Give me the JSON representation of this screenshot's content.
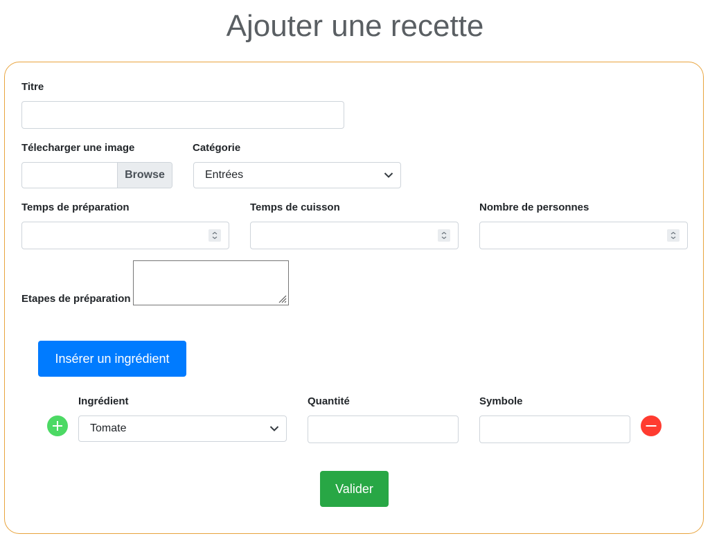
{
  "page": {
    "title": "Ajouter une recette"
  },
  "form": {
    "titre": {
      "label": "Titre",
      "value": ""
    },
    "image": {
      "label": "Télecharger une image",
      "browse_label": "Browse"
    },
    "categorie": {
      "label": "Catégorie",
      "selected": "Entrées"
    },
    "temps_preparation": {
      "label": "Temps de préparation",
      "value": ""
    },
    "temps_cuisson": {
      "label": "Temps de cuisson",
      "value": ""
    },
    "nombre_personnes": {
      "label": "Nombre de personnes",
      "value": ""
    },
    "etapes": {
      "label": "Etapes de préparation",
      "value": ""
    },
    "insert_ingredient_label": "Insérer un ingrédient",
    "ingredient_row": {
      "ingredient_label": "Ingrédient",
      "ingredient_selected": "Tomate",
      "quantite_label": "Quantité",
      "quantite_value": "",
      "symbole_label": "Symbole",
      "symbole_value": ""
    },
    "submit_label": "Valider"
  },
  "colors": {
    "card_border": "#e8a33c",
    "primary": "#007bff",
    "success": "#28a745",
    "add_icon": "#4cd964",
    "remove_icon": "#ff3b30"
  }
}
